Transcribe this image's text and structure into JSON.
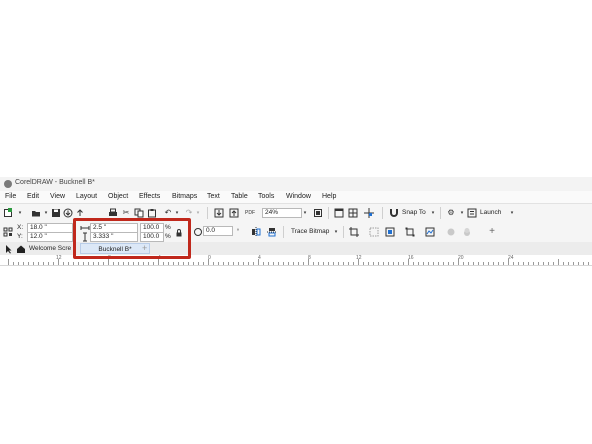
{
  "window": {
    "title": "CorelDRAW - Bucknell B*"
  },
  "menu": [
    "File",
    "Edit",
    "View",
    "Layout",
    "Object",
    "Effects",
    "Bitmaps",
    "Text",
    "Table",
    "Tools",
    "Window",
    "Help"
  ],
  "toolbar1": {
    "zoom_value": "24%",
    "snap_label": "Snap To",
    "launch_label": "Launch"
  },
  "toolbar2": {
    "x_label": "X:",
    "x_value": "18.0 \"",
    "y_label": "Y:",
    "y_value": "12.0 \"",
    "width_value": "2.5 \"",
    "height_value": "3.333 \"",
    "scale_w": "100.0",
    "scale_h": "100.0",
    "pct_w": "%",
    "pct_h": "%",
    "rotation_value": "0.0",
    "trace_bitmap_label": "Trace Bitmap"
  },
  "tabs": {
    "welcome": "Welcome Scre",
    "document": "Bucknell B*",
    "add_symbol": "+"
  },
  "ruler_labels": [
    "12",
    "8",
    "4",
    "0",
    "4",
    "8",
    "12",
    "16",
    "20",
    "24"
  ],
  "colors": {
    "highlight": "#c0281c",
    "accent": "#1f6fd0",
    "tab_active": "#dce8f7"
  }
}
